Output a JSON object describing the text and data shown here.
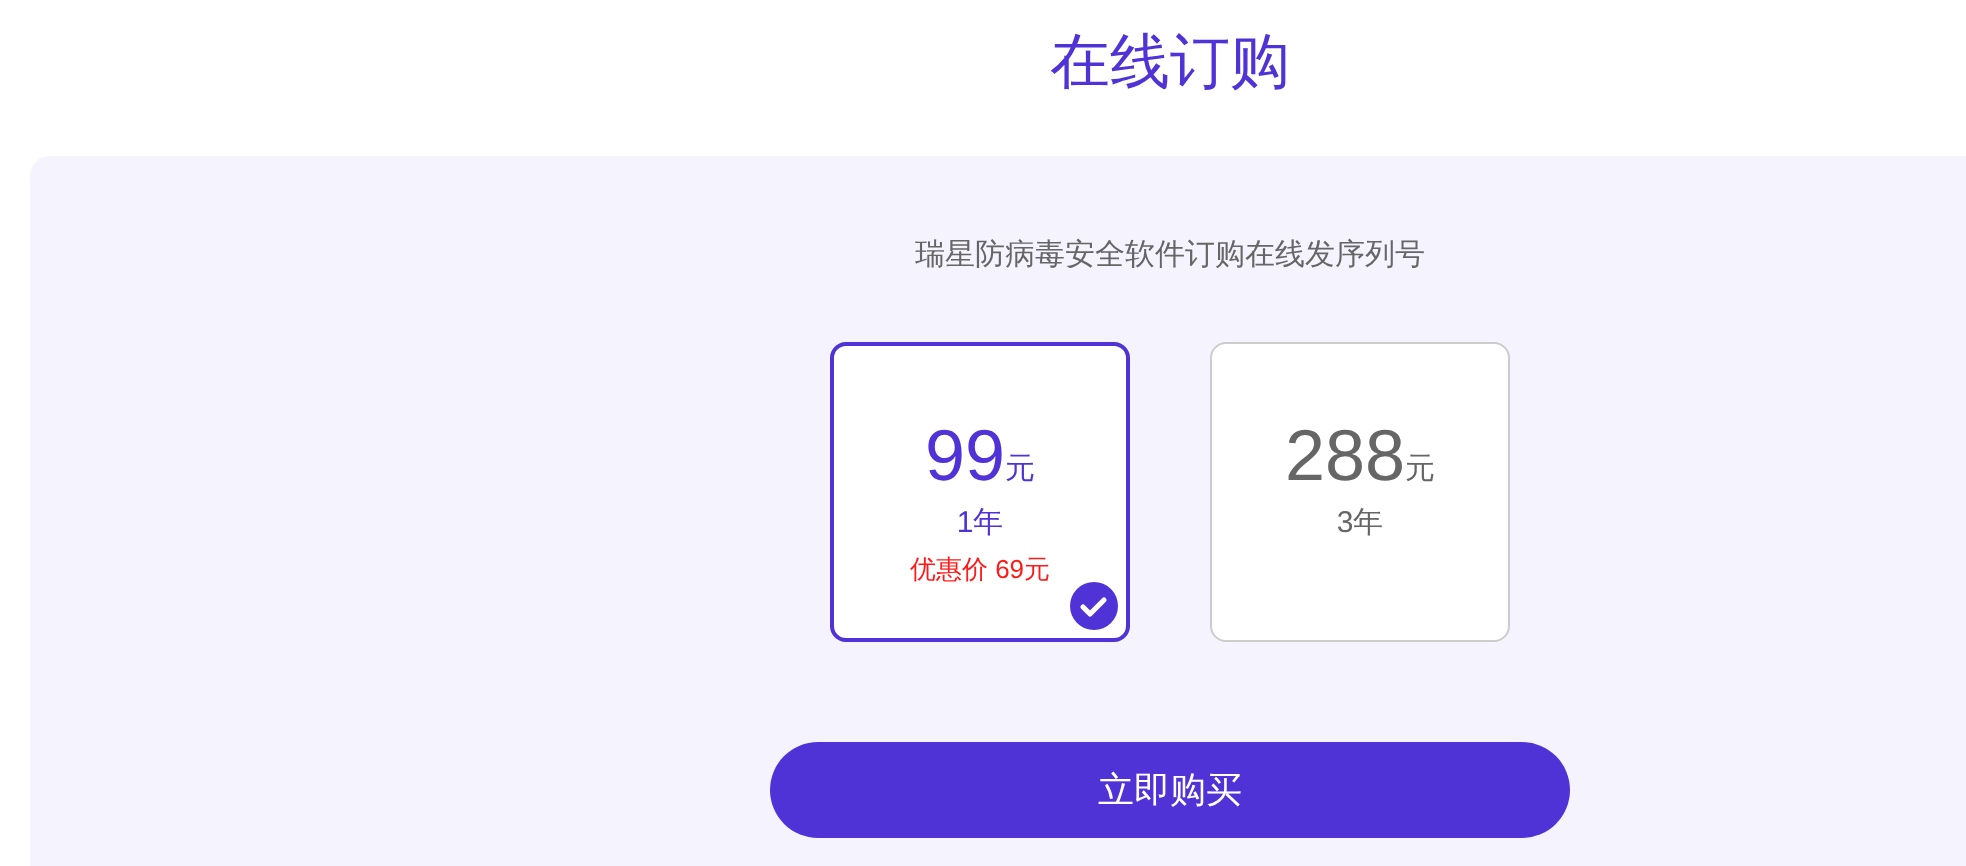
{
  "title": "在线订购",
  "subtitle": "瑞星防病毒安全软件订购在线发序列号",
  "plans": [
    {
      "price": "99",
      "unit": "元",
      "term": "1年",
      "promo": "优惠价 69元",
      "selected": true
    },
    {
      "price": "288",
      "unit": "元",
      "term": "3年",
      "selected": false
    }
  ],
  "buy_button": "立即购买"
}
